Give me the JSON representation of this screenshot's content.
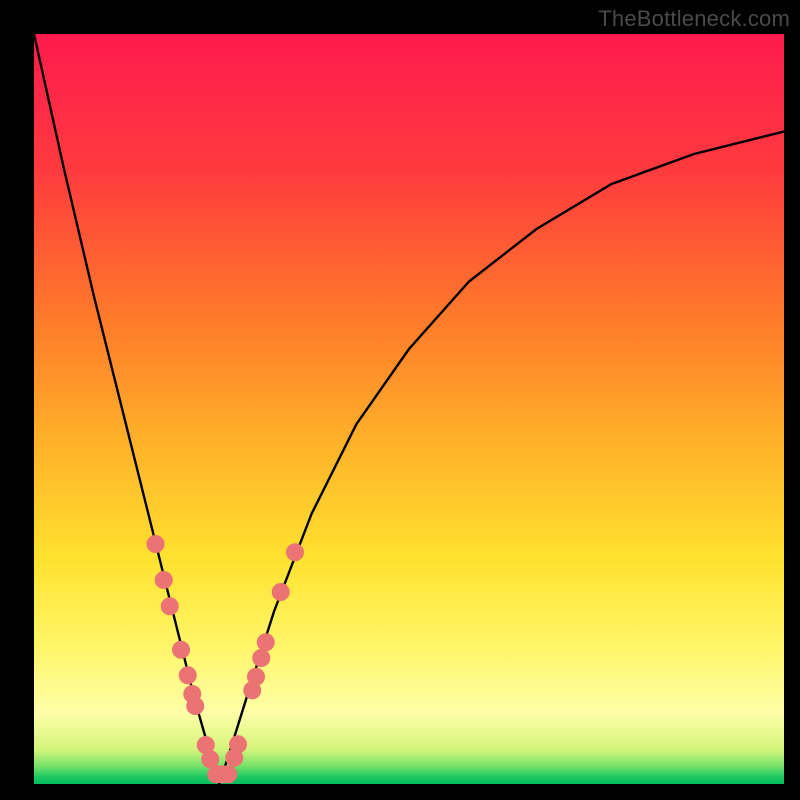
{
  "watermark": "TheBottleneck.com",
  "colors": {
    "frame": "#000000",
    "curve": "#000000",
    "dot_fill": "#ec7373",
    "dot_stroke": "#d86262",
    "gradient_stops": [
      {
        "offset": 0.0,
        "color": "#ff1a4e"
      },
      {
        "offset": 0.18,
        "color": "#ff3a3f"
      },
      {
        "offset": 0.38,
        "color": "#ff7a2a"
      },
      {
        "offset": 0.55,
        "color": "#ffb329"
      },
      {
        "offset": 0.7,
        "color": "#ffe22f"
      },
      {
        "offset": 0.82,
        "color": "#fff66a"
      },
      {
        "offset": 0.905,
        "color": "#ffffa8"
      },
      {
        "offset": 0.955,
        "color": "#d3f47a"
      },
      {
        "offset": 0.975,
        "color": "#7be36a"
      },
      {
        "offset": 0.99,
        "color": "#20c964"
      },
      {
        "offset": 1.0,
        "color": "#05bd5e"
      }
    ]
  },
  "chart_data": {
    "type": "line",
    "title": "",
    "xlabel": "",
    "ylabel": "",
    "xlim": [
      0,
      1
    ],
    "ylim": [
      0,
      1
    ],
    "note": "Axes are unlabeled in the source image; values are normalized fractions of the plotting area. Curve is a V-shaped bottleneck profile; minimum near x≈0.247.",
    "series": [
      {
        "name": "bottleneck-curve",
        "x": [
          0.0,
          0.04,
          0.08,
          0.12,
          0.16,
          0.19,
          0.215,
          0.235,
          0.247,
          0.26,
          0.285,
          0.32,
          0.37,
          0.43,
          0.5,
          0.58,
          0.67,
          0.77,
          0.88,
          1.0
        ],
        "y": [
          1.0,
          0.82,
          0.65,
          0.49,
          0.33,
          0.21,
          0.11,
          0.04,
          0.0,
          0.04,
          0.12,
          0.23,
          0.36,
          0.48,
          0.58,
          0.67,
          0.74,
          0.8,
          0.84,
          0.87
        ]
      }
    ],
    "points": [
      {
        "name": "dot",
        "x": 0.162,
        "y": 0.32
      },
      {
        "name": "dot",
        "x": 0.173,
        "y": 0.272
      },
      {
        "name": "dot",
        "x": 0.181,
        "y": 0.237
      },
      {
        "name": "dot",
        "x": 0.196,
        "y": 0.179
      },
      {
        "name": "dot",
        "x": 0.205,
        "y": 0.145
      },
      {
        "name": "dot",
        "x": 0.211,
        "y": 0.12
      },
      {
        "name": "dot",
        "x": 0.215,
        "y": 0.104
      },
      {
        "name": "dot",
        "x": 0.229,
        "y": 0.052
      },
      {
        "name": "dot",
        "x": 0.235,
        "y": 0.033
      },
      {
        "name": "dot",
        "x": 0.243,
        "y": 0.013
      },
      {
        "name": "dot",
        "x": 0.251,
        "y": 0.013
      },
      {
        "name": "dot",
        "x": 0.259,
        "y": 0.013
      },
      {
        "name": "dot",
        "x": 0.267,
        "y": 0.035
      },
      {
        "name": "dot",
        "x": 0.272,
        "y": 0.053
      },
      {
        "name": "dot",
        "x": 0.291,
        "y": 0.125
      },
      {
        "name": "dot",
        "x": 0.296,
        "y": 0.143
      },
      {
        "name": "dot",
        "x": 0.303,
        "y": 0.168
      },
      {
        "name": "dot",
        "x": 0.309,
        "y": 0.189
      },
      {
        "name": "dot",
        "x": 0.329,
        "y": 0.256
      },
      {
        "name": "dot",
        "x": 0.348,
        "y": 0.309
      }
    ],
    "dot_radius_px": 9
  }
}
